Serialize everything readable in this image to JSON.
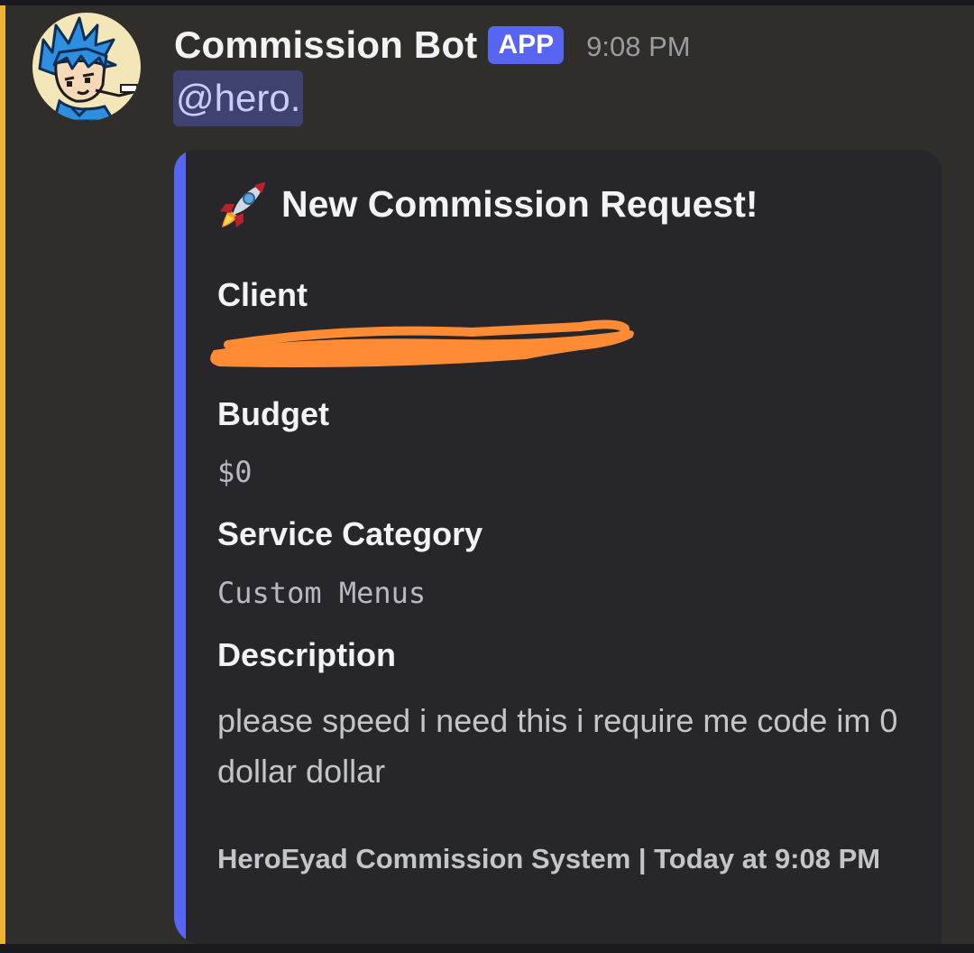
{
  "message": {
    "author": "Commission Bot",
    "badge": "APP",
    "timestamp": "9:08 PM",
    "mention": "@hero.",
    "avatar_icon": "cartoon-blue-hair-avatar"
  },
  "embed": {
    "title_icon": "rocket-icon",
    "title": "New Commission Request!",
    "accent_color": "#5865f2",
    "fields": {
      "client_name": "Client",
      "client_value_redacted": true,
      "budget_name": "Budget",
      "budget_value": "$0",
      "category_name": "Service Category",
      "category_value": "Custom Menus",
      "description_name": "Description",
      "description_value": "please speed i need this i require me code im 0 dollar dollar"
    },
    "footer": "HeroEyad Commission System | Today at 9:08 PM"
  },
  "colors": {
    "mention_highlight_bar": "#f0b232",
    "app_badge": "#5865f2",
    "redaction": "#ff8c35"
  }
}
